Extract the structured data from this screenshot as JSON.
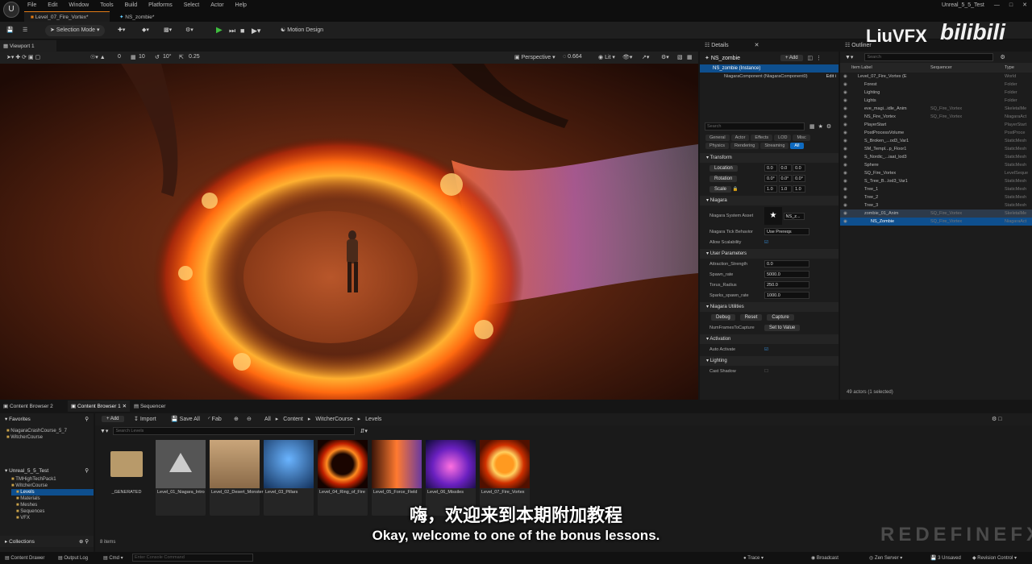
{
  "menu": {
    "items": [
      "File",
      "Edit",
      "Window",
      "Tools",
      "Build",
      "Platforms",
      "Select",
      "Actor",
      "Help"
    ],
    "project_name": "Unreal_5_5_Test"
  },
  "doc_tabs": [
    "Level_07_Fire_Vortex*",
    "NS_zombie*"
  ],
  "toolbar": {
    "selection_mode": "Selection Mode",
    "motion_design": "Motion Design"
  },
  "viewport": {
    "tab": "Viewport 1",
    "perspective": "Perspective",
    "lit": "Lit",
    "fov": "0.664",
    "grid_snap": "10",
    "rot_snap": "10°",
    "scale_snap": "0.25",
    "cam_speed": "0"
  },
  "details": {
    "tab": "Details",
    "object": "NS_zombie",
    "add_label": "+ Add",
    "instance": "NS_zombie (Instance)",
    "component": "NiagaraComponent (NiagaraComponent0)",
    "edit_label": "Edit i",
    "search_placeholder": "Search",
    "filters": [
      "General",
      "Actor",
      "Effects",
      "LOD",
      "Misc",
      "Physics",
      "Rendering",
      "Streaming",
      "All"
    ],
    "transform_title": "Transform",
    "location_label": "Location",
    "rotation_label": "Rotation",
    "scale_label": "Scale",
    "location": [
      "0.0",
      "0.0",
      "0.0"
    ],
    "rotation": [
      "0.0°",
      "0.0°",
      "0.0°"
    ],
    "scale": [
      "1.0",
      "1.0",
      "1.0"
    ],
    "niagara_title": "Niagara",
    "system_asset_label": "Niagara System Asset",
    "system_asset_value": "NS_z...",
    "tick_behavior_label": "Niagara Tick Behavior",
    "tick_behavior_value": "Use Prereqs",
    "allow_scalability_label": "Allow Scalability",
    "user_params_title": "User Parameters",
    "user_params": [
      {
        "label": "Attraction_Strength",
        "value": "0.0"
      },
      {
        "label": "Spawn_rate",
        "value": "5000.0"
      },
      {
        "label": "Torus_Radius",
        "value": "250.0"
      },
      {
        "label": "Sparks_spawn_rate",
        "value": "1000.0"
      }
    ],
    "utilities_title": "Niagara Utilities",
    "debug_label": "Debug",
    "reset_label": "Reset",
    "capture_label": "Capture",
    "num_frames_label": "NumFramesToCapture",
    "set_to_value_label": "Set to Value",
    "activation_title": "Activation",
    "auto_activate_label": "Auto Activate",
    "lighting_title": "Lighting",
    "cast_shadow_label": "Cast Shadow"
  },
  "outliner": {
    "tab": "Outliner",
    "search_placeholder": "Search",
    "columns": [
      "Item Label",
      "Sequencer",
      "Type"
    ],
    "rows": [
      {
        "label": "Level_07_Fire_Vortex (E",
        "seq": "",
        "type": "World",
        "indent": 1
      },
      {
        "label": "Forest",
        "seq": "",
        "type": "Folder",
        "indent": 2
      },
      {
        "label": "Lighting",
        "seq": "",
        "type": "Folder",
        "indent": 2
      },
      {
        "label": "Lights",
        "seq": "",
        "type": "Folder",
        "indent": 2
      },
      {
        "label": "eve_magi...idle_Anim",
        "seq": "SQ_Fire_Vortex",
        "type": "SkeletalMe",
        "indent": 2
      },
      {
        "label": "NS_Fire_Vortex",
        "seq": "SQ_Fire_Vortex",
        "type": "NiagaraAct",
        "indent": 2
      },
      {
        "label": "PlayerStart",
        "seq": "",
        "type": "PlayerStart",
        "indent": 2
      },
      {
        "label": "PostProcessVolume",
        "seq": "",
        "type": "PostProce",
        "indent": 2
      },
      {
        "label": "S_Broken_...od3_Var1",
        "seq": "",
        "type": "StaticMesh",
        "indent": 2
      },
      {
        "label": "SM_Templ...p_Floor1",
        "seq": "",
        "type": "StaticMesh",
        "indent": 2
      },
      {
        "label": "S_Nordic_...iaat_lod3",
        "seq": "",
        "type": "StaticMesh",
        "indent": 2
      },
      {
        "label": "Sphere",
        "seq": "",
        "type": "StaticMesh",
        "indent": 2
      },
      {
        "label": "SQ_Fire_Vortex",
        "seq": "",
        "type": "LevelSeque",
        "indent": 2
      },
      {
        "label": "S_Tree_B...lod3_Var1",
        "seq": "",
        "type": "StaticMesh",
        "indent": 2
      },
      {
        "label": "Tree_1",
        "seq": "",
        "type": "StaticMesh",
        "indent": 2
      },
      {
        "label": "Tree_2",
        "seq": "",
        "type": "StaticMesh",
        "indent": 2
      },
      {
        "label": "Tree_3",
        "seq": "",
        "type": "StaticMesh",
        "indent": 2
      },
      {
        "label": "zombie_01_Anim",
        "seq": "SQ_Fire_Vortex",
        "type": "SkeletalMe",
        "indent": 2
      },
      {
        "label": "NS_Zombie",
        "seq": "SQ_Fire_Vortex",
        "type": "NiagaraAct",
        "indent": 3
      }
    ],
    "footer": "49 actors (1 selected)"
  },
  "content_browser": {
    "tabs": [
      "Content Browser 2",
      "Content Browser 1",
      "Sequencer"
    ],
    "add_label": "+ Add",
    "import_label": "Import",
    "save_all_label": "Save All",
    "fab_label": "Fab",
    "path": [
      "All",
      "Content",
      "WitcherCourse",
      "Levels"
    ],
    "search_placeholder": "Search Levels",
    "favorites_title": "Favorites",
    "favorites": [
      "NiagaraCrashCourse_5_7",
      "WitcherCourse"
    ],
    "project_title": "Unreal_5_5_Test",
    "tree": [
      "TMHighTechPack1",
      "WitcherCourse",
      "Levels",
      "Materials",
      "Meshes",
      "Sequences",
      "VFX"
    ],
    "collections_label": "Collections",
    "assets": [
      {
        "name": "_GENERATED",
        "kind": "folder"
      },
      {
        "name": "Level_01_Niagara_Intro",
        "kind": "level"
      },
      {
        "name": "Level_02_Desert_Monster",
        "kind": "level"
      },
      {
        "name": "Level_03_Pillars",
        "kind": "level"
      },
      {
        "name": "Level_04_Ring_of_Fire",
        "kind": "level"
      },
      {
        "name": "Level_05_Force_Field",
        "kind": "level"
      },
      {
        "name": "Level_06_Missiles",
        "kind": "level"
      },
      {
        "name": "Level_07_Fire_Vortex",
        "kind": "level"
      }
    ],
    "item_count": "8 items"
  },
  "status": {
    "content_drawer": "Content Drawer",
    "output_log": "Output Log",
    "cmd": "Cmd",
    "console_placeholder": "Enter Console Command",
    "trace": "Trace",
    "broadcast": "Broadcast",
    "zen": "Zen Server",
    "unsaved": "3 Unsaved",
    "revision": "Revision Control"
  },
  "overlay": {
    "subtitle_cn": "嗨，欢迎来到本期附加教程",
    "subtitle_en": "Okay, welcome to one of the bonus lessons.",
    "watermark_author": "LiuVFX",
    "watermark_site": "bilibili",
    "watermark_brand": "REDEFINEFX"
  },
  "colors": {
    "accent": "#e07b17",
    "selection": "#0e6ac0",
    "play": "#3fbf3f"
  }
}
